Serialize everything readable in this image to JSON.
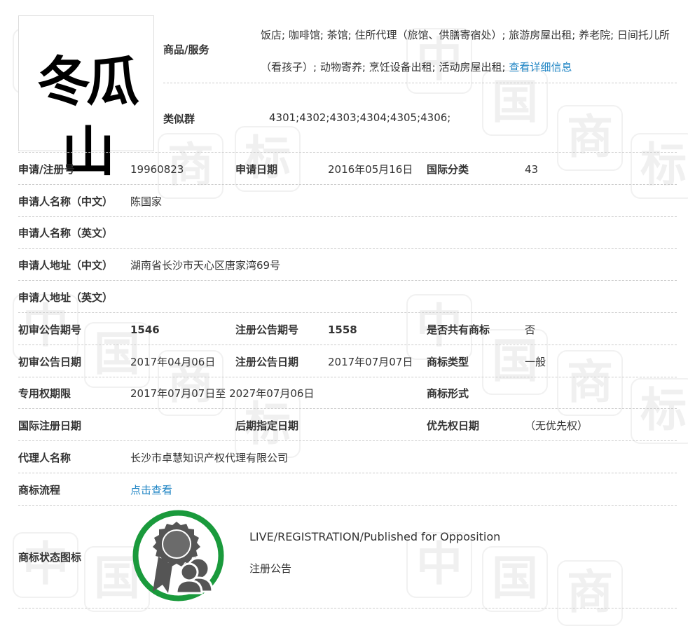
{
  "logo": {
    "text": "冬瓜山"
  },
  "goods": {
    "label": "商品/服务",
    "text": "饭店; 咖啡馆; 茶馆; 住所代理（旅馆、供膳寄宿处）; 旅游房屋出租; 养老院; 日间托儿所（看孩子）; 动物寄养; 烹饪设备出租; 活动房屋出租;",
    "link": "查看详细信息"
  },
  "similar_group": {
    "label": "类似群",
    "value": "4301;4302;4303;4304;4305;4306;"
  },
  "rows": {
    "r1": {
      "l1": "申请/注册号",
      "v1": "19960823",
      "l2": "申请日期",
      "v2": "2016年05月16日",
      "l3": "国际分类",
      "v3": "43"
    },
    "r2": {
      "l1": "申请人名称（中文）",
      "v1": "陈国家"
    },
    "r3": {
      "l1": "申请人名称（英文）"
    },
    "r4": {
      "l1": "申请人地址（中文）",
      "v1": "湖南省长沙市天心区唐家湾69号"
    },
    "r5": {
      "l1": "申请人地址（英文）"
    },
    "r6": {
      "l1": "初审公告期号",
      "v1": "1546",
      "l2": "注册公告期号",
      "v2": "1558",
      "l3": "是否共有商标",
      "v3": "否"
    },
    "r7": {
      "l1": "初审公告日期",
      "v1": "2017年04月06日",
      "l2": "注册公告日期",
      "v2": "2017年07月07日",
      "l3": "商标类型",
      "v3": "一般"
    },
    "r8": {
      "l1": "专用权期限",
      "v1": "2017年07月07日至 2027年07月06日",
      "l3": "商标形式"
    },
    "r9": {
      "l1": "国际注册日期",
      "l2": "后期指定日期",
      "l3": "优先权日期",
      "v3": "（无优先权）"
    },
    "r10": {
      "l1": "代理人名称",
      "v1": "长沙市卓慧知识产权代理有限公司"
    },
    "r11": {
      "l1": "商标流程",
      "link": "点击查看"
    }
  },
  "status": {
    "label": "商标状态图标",
    "english": "LIVE/REGISTRATION/Published for Opposition",
    "chinese": "注册公告",
    "icon": "award-ribbon-people-icon",
    "ring_color": "#1a9a3c",
    "icon_color": "#555555"
  },
  "colors": {
    "link": "#1e84c4",
    "divider": "#cccccc",
    "watermark": "#f0f0f0"
  }
}
